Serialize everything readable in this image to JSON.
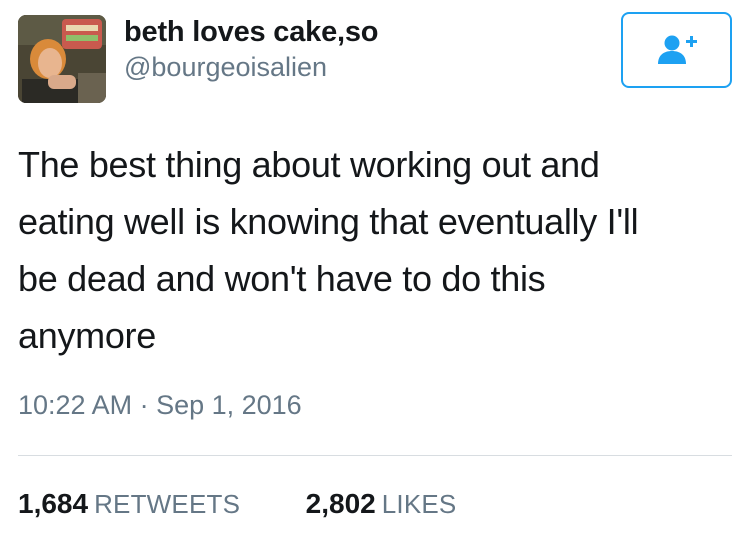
{
  "user": {
    "display_name": "beth loves cake,so",
    "handle": "@bourgeoisalien"
  },
  "follow_button": {
    "icon": "follow-user-plus-icon"
  },
  "tweet": {
    "text": "The best thing about working out and\neating well is knowing that eventually I'll\nbe dead and won't have to do this\nanymore",
    "timestamp": "10:22 AM · Sep 1, 2016"
  },
  "stats": {
    "retweets_count": "1,684",
    "retweets_label": "RETWEETS",
    "likes_count": "2,802",
    "likes_label": "LIKES"
  },
  "colors": {
    "accent": "#1da1f2",
    "text": "#14171a",
    "secondary_text": "#657786",
    "divider": "#d8dde1"
  }
}
